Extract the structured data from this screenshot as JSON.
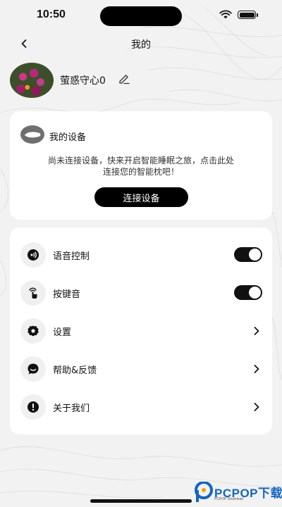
{
  "status_bar": {
    "time": "10:50"
  },
  "header": {
    "title": "我的",
    "back_icon": "chevron-left-icon"
  },
  "profile": {
    "username": "萤惑守心0",
    "edit_icon": "pencil-icon"
  },
  "device_card": {
    "icon": "device-pillow-icon",
    "title": "我的设备",
    "description_line1": "尚未连接设备，快来开启智能睡眠之旅，点击此处",
    "description_line2": "连接您的智能枕吧！",
    "connect_button": "连接设备"
  },
  "settings": {
    "items": [
      {
        "label": "语音控制",
        "icon": "voice-control-icon",
        "control": "toggle",
        "value": true
      },
      {
        "label": "按键音",
        "icon": "tap-sound-icon",
        "control": "toggle",
        "value": true
      },
      {
        "label": "设置",
        "icon": "gear-icon",
        "control": "chevron"
      },
      {
        "label": "帮助&反馈",
        "icon": "chat-icon",
        "control": "chevron"
      },
      {
        "label": "关于我们",
        "icon": "info-icon",
        "control": "chevron"
      }
    ]
  },
  "watermark": {
    "text": "PCPOP下载",
    "sub": "PCPOP Download"
  },
  "colors": {
    "background": "#f2f2f2",
    "card": "#ffffff",
    "accent": "#000000",
    "toggle_on": "#111111"
  }
}
